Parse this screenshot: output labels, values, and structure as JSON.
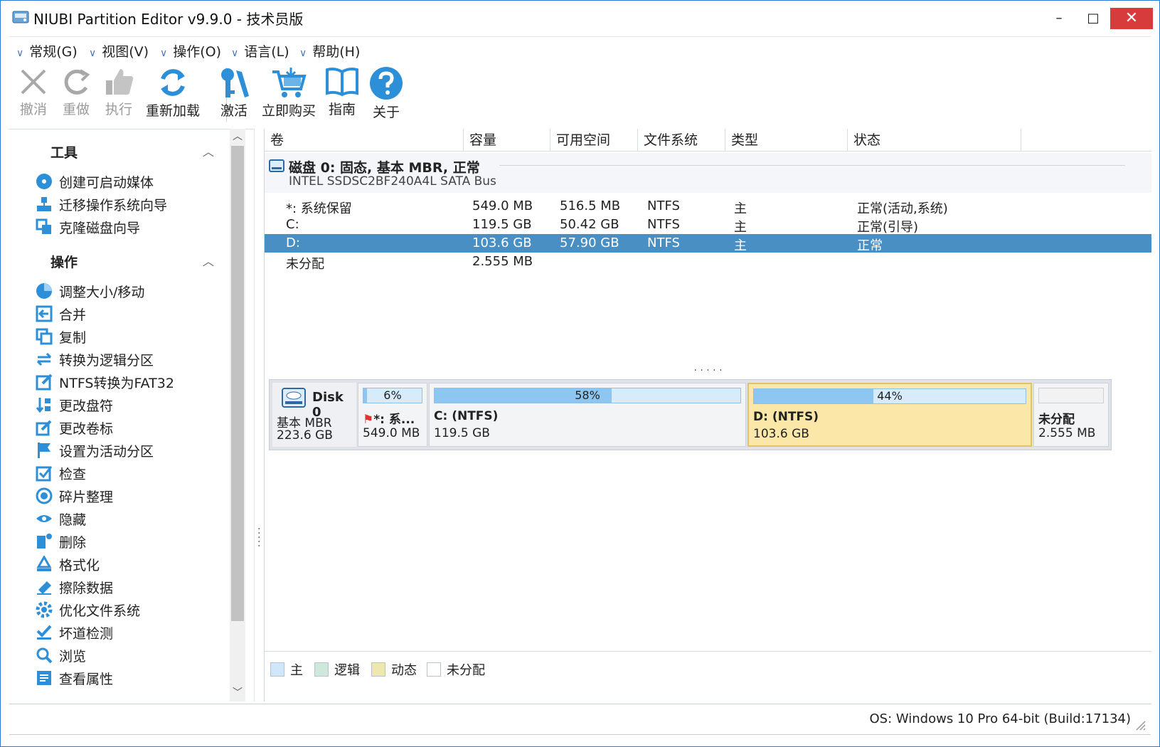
{
  "window": {
    "title": "NIUBI Partition Editor v9.9.0 - 技术员版",
    "min": "–",
    "max": "□",
    "close": "✕"
  },
  "menu": [
    {
      "label": "常规(G)"
    },
    {
      "label": "视图(V)"
    },
    {
      "label": "操作(O)"
    },
    {
      "label": "语言(L)"
    },
    {
      "label": "帮助(H)"
    }
  ],
  "toolbar": {
    "undo": "撤消",
    "redo": "重做",
    "apply": "执行",
    "reload": "重新加载",
    "activate": "激活",
    "buy": "立即购买",
    "guide": "指南",
    "about": "关于"
  },
  "sidebar": {
    "tools_head": "工具",
    "tools": [
      {
        "label": "创建可启动媒体"
      },
      {
        "label": "迁移操作系统向导"
      },
      {
        "label": "克隆磁盘向导"
      }
    ],
    "ops_head": "操作",
    "ops": [
      {
        "label": "调整大小/移动"
      },
      {
        "label": "合并"
      },
      {
        "label": "复制"
      },
      {
        "label": "转换为逻辑分区"
      },
      {
        "label": "NTFS转换为FAT32"
      },
      {
        "label": "更改盘符"
      },
      {
        "label": "更改卷标"
      },
      {
        "label": "设置为活动分区"
      },
      {
        "label": "检查"
      },
      {
        "label": "碎片整理"
      },
      {
        "label": "隐藏"
      },
      {
        "label": "删除"
      },
      {
        "label": "格式化"
      },
      {
        "label": "擦除数据"
      },
      {
        "label": "优化文件系统"
      },
      {
        "label": "坏道检测"
      },
      {
        "label": "浏览"
      },
      {
        "label": "查看属性"
      }
    ]
  },
  "table": {
    "columns": [
      "卷",
      "容量",
      "可用空间",
      "文件系统",
      "类型",
      "状态"
    ],
    "disk_title": "磁盘 0: 固态, 基本 MBR, 正常",
    "disk_sub": "INTEL SSDSC2BF240A4L SATA Bus",
    "rows": [
      {
        "vol": "*: 系统保留",
        "cap": "549.0 MB",
        "free": "516.5 MB",
        "fs": "NTFS",
        "type": "主",
        "status": "正常(活动,系统)"
      },
      {
        "vol": "C:",
        "cap": "119.5 GB",
        "free": "50.42 GB",
        "fs": "NTFS",
        "type": "主",
        "status": "正常(引导)"
      },
      {
        "vol": "D:",
        "cap": "103.6 GB",
        "free": "57.90 GB",
        "fs": "NTFS",
        "type": "主",
        "status": "正常"
      },
      {
        "vol": "未分配",
        "cap": "2.555 MB",
        "free": "",
        "fs": "",
        "type": "",
        "status": ""
      }
    ]
  },
  "diskmap": {
    "disk_name": "Disk 0",
    "disk_type": "基本 MBR",
    "disk_size": "223.6 GB",
    "parts": [
      {
        "pct": "6%",
        "used": 0.06,
        "name": "*: 系...",
        "size": "549.0 MB"
      },
      {
        "pct": "58%",
        "used": 0.58,
        "name": "C: (NTFS)",
        "size": "119.5 GB"
      },
      {
        "pct": "44%",
        "used": 0.44,
        "name": "D: (NTFS)",
        "size": "103.6 GB"
      },
      {
        "pct": "",
        "used": 0,
        "name": "未分配",
        "size": "2.555 MB"
      }
    ]
  },
  "legend": {
    "primary": "主",
    "logical": "逻辑",
    "dynamic": "动态",
    "unallocated": "未分配"
  },
  "status": {
    "os": "OS: Windows 10 Pro 64-bit (Build:17134)"
  },
  "colors": {
    "selection": "#4a8fc4",
    "accent": "#2b7bd4",
    "bar_fill": "#8ec6f2",
    "selected_part": "#fbe7a8",
    "close": "#d83b3b"
  }
}
